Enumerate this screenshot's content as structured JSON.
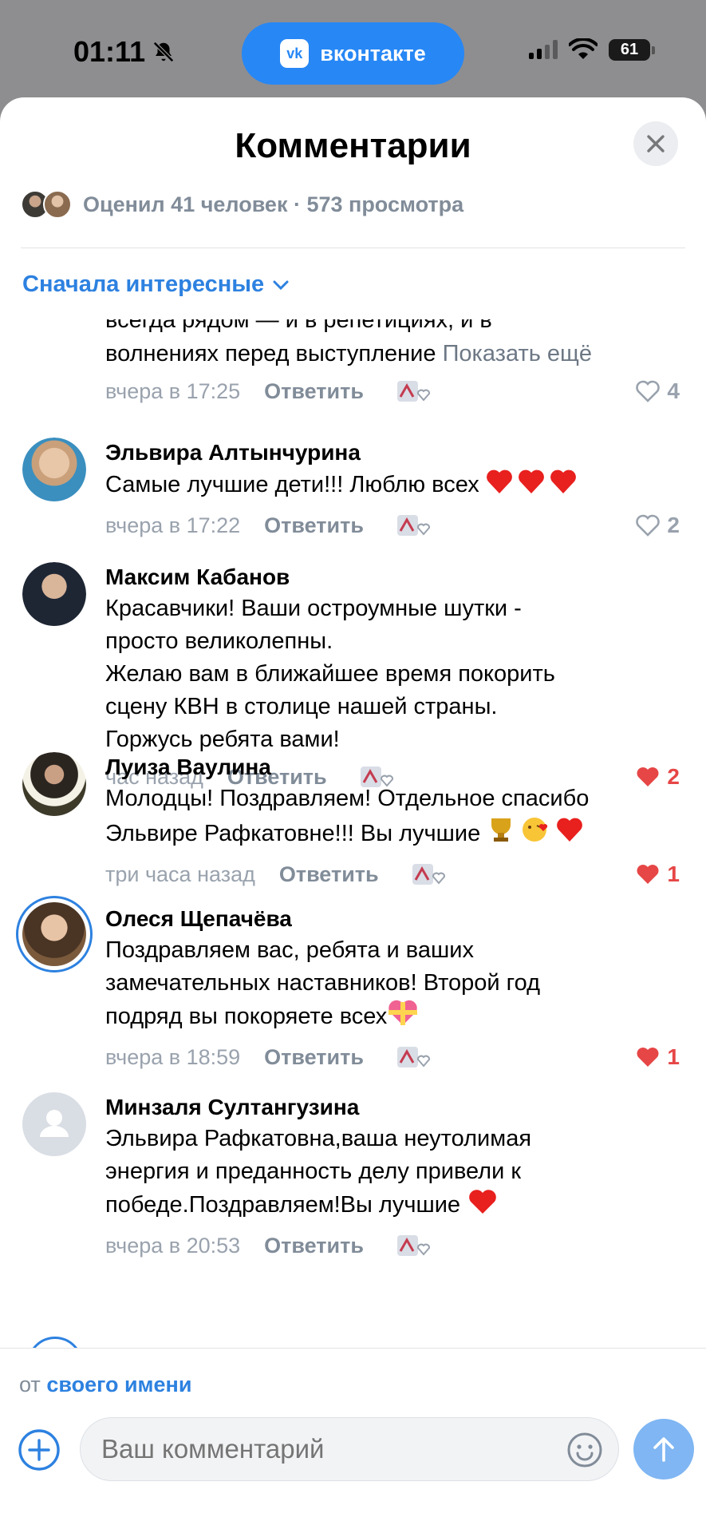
{
  "status_bar": {
    "time": "01:11",
    "app_pill_label": "вконтакте",
    "app_logo_text": "vk",
    "battery": "61"
  },
  "sheet": {
    "title": "Комментарии",
    "stats_text": "Оценил 41 человек · 573 просмотра",
    "sort_label": "Сначала интересные"
  },
  "partial_comment": {
    "text_cut": "всегда рядом — и в репетициях, и в",
    "text_line": "волнениях перед выступление",
    "show_more": "Показать ещё",
    "time": "вчера в 17:25",
    "reply": "Ответить",
    "likes": "4"
  },
  "comments": [
    {
      "name": "Эльвира Алтынчурина",
      "text": "Самые лучшие дети!!! Люблю всех",
      "time": "вчера в 17:22",
      "reply": "Ответить",
      "likes": "2",
      "liked": false
    },
    {
      "name": "Максим Кабанов",
      "text": "Красавчики! Ваши остроумные шутки -\nпросто великолепны.\nЖелаю вам в ближайшее время покорить\nсцену КВН в столице нашей страны.\nГоржусь ребята вами!",
      "time": "час назад",
      "reply": "Ответить",
      "likes": "2",
      "liked": true
    },
    {
      "name": "Луиза Ваулина",
      "text": "Молодцы! Поздравляем! Отдельное спасибо\nЭльвире Рафкатовне!!! Вы лучшие",
      "time": "три часа назад",
      "reply": "Ответить",
      "likes": "1",
      "liked": true
    },
    {
      "name": "Олеся Щепачёва",
      "text": "Поздравляем вас, ребята и ваших\nзамечательных наставников! Второй год\nподряд вы покоряете всех",
      "time": "вчера в 18:59",
      "reply": "Ответить",
      "likes": "1",
      "liked": true
    },
    {
      "name": "Минзаля Султангузина",
      "text": "Эльвира Рафкатовна,ваша неутолимая\nэнергия и преданность делу привели к\nпобеде.Поздравляем!Вы лучшие",
      "time": "вчера в 20:53",
      "reply": "Ответить",
      "likes": "",
      "liked": false
    }
  ],
  "composer": {
    "from_prefix": "от",
    "from_link": "своего имени",
    "placeholder": "Ваш комментарий"
  },
  "colors": {
    "accent": "#2d81e0",
    "like_active": "#e64646",
    "muted": "#818c99"
  }
}
